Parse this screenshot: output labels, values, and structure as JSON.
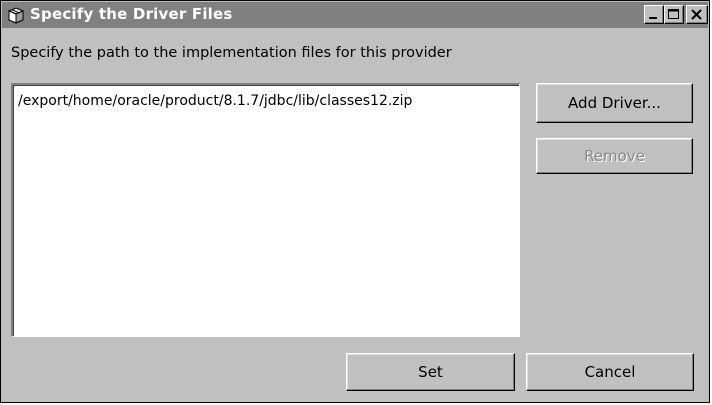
{
  "window": {
    "title": "Specify the Driver Files",
    "title_icon": "package-icon",
    "controls": {
      "minimize_icon": "minimize-icon",
      "maximize_icon": "maximize-icon",
      "close_icon": "close-icon"
    }
  },
  "main": {
    "instruction": "Specify the path to the implementation files for this provider",
    "files": [
      "/export/home/oracle/product/8.1.7/jdbc/lib/classes12.zip"
    ]
  },
  "buttons": {
    "add_driver": "Add Driver...",
    "remove": "Remove",
    "set": "Set",
    "cancel": "Cancel"
  },
  "state": {
    "remove_enabled": false
  },
  "colors": {
    "title_bar": "#808080",
    "dialog_bg": "#c0c0c0",
    "list_bg": "#ffffff",
    "disabled_text": "#8a8a8a"
  }
}
